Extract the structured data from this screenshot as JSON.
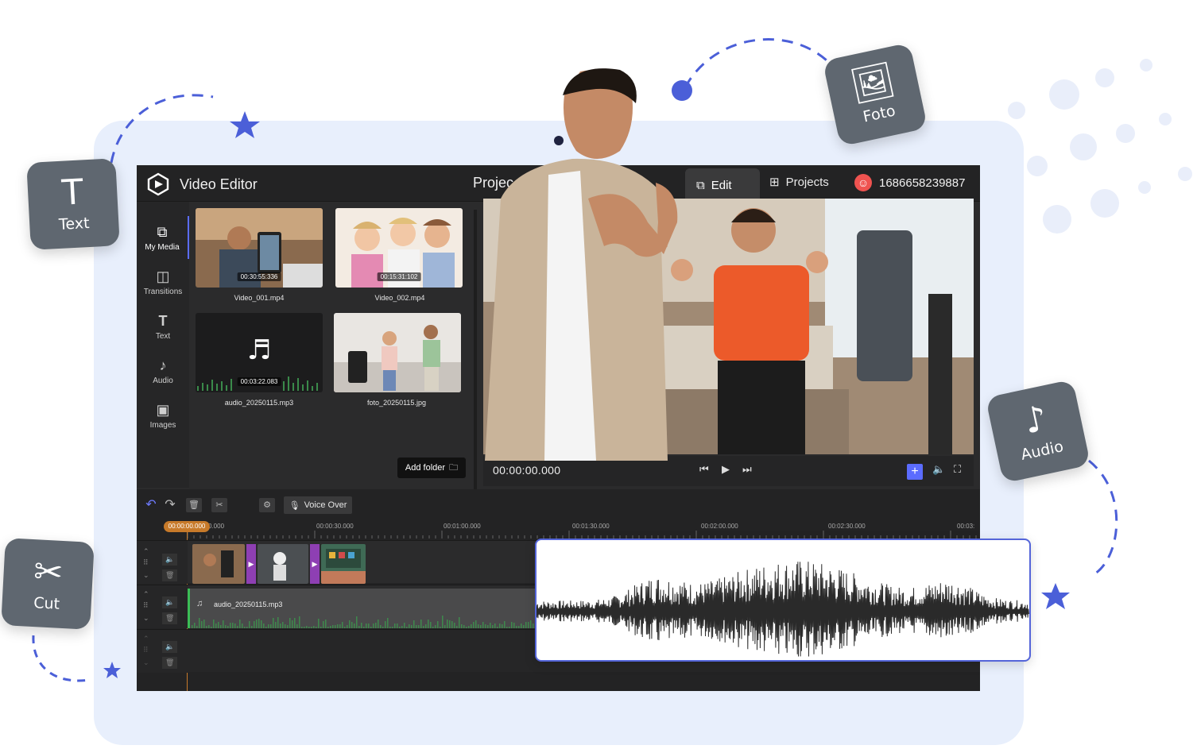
{
  "header": {
    "app_title": "Video Editor",
    "project_label": "Projec",
    "tab_edit": "Edit",
    "tab_projects": "Projects",
    "user_id": "1686658239887"
  },
  "sidebar": {
    "items": [
      {
        "label": "My Media",
        "icon": "media-icon"
      },
      {
        "label": "Transitions",
        "icon": "transitions-icon"
      },
      {
        "label": "Text",
        "icon": "text-icon"
      },
      {
        "label": "Audio",
        "icon": "audio-icon"
      },
      {
        "label": "Images",
        "icon": "images-icon"
      }
    ]
  },
  "media": {
    "items": [
      {
        "name": "Video_001.mp4",
        "duration": "00:30:55:336"
      },
      {
        "name": "Video_002.mp4",
        "duration": "00:15:31:102"
      },
      {
        "name": "audio_20250115.mp3",
        "duration": "00:03:22.083"
      },
      {
        "name": "foto_20250115.jpg",
        "duration": ""
      }
    ],
    "add_folder": "Add folder"
  },
  "player": {
    "timecode": "00:00:00.000"
  },
  "timeline": {
    "voice_over": "Voice Over",
    "playhead": "00:00:00.000",
    "ruler": [
      "0.000",
      "00:00:30.000",
      "00:01:00.000",
      "00:01:30.000",
      "00:02:00.000",
      "00:02:30.000",
      "00:03:"
    ],
    "audio_clip_name": "audio_20250115.mp3"
  },
  "badges": {
    "text": "Text",
    "foto": "Foto",
    "audio": "Audio",
    "cut": "Cut"
  },
  "colors": {
    "accent": "#5b6cff",
    "backdrop": "#e8effc",
    "badge": "#5f6770",
    "playhead": "#c77a2a",
    "transition": "#8e3fb3"
  }
}
